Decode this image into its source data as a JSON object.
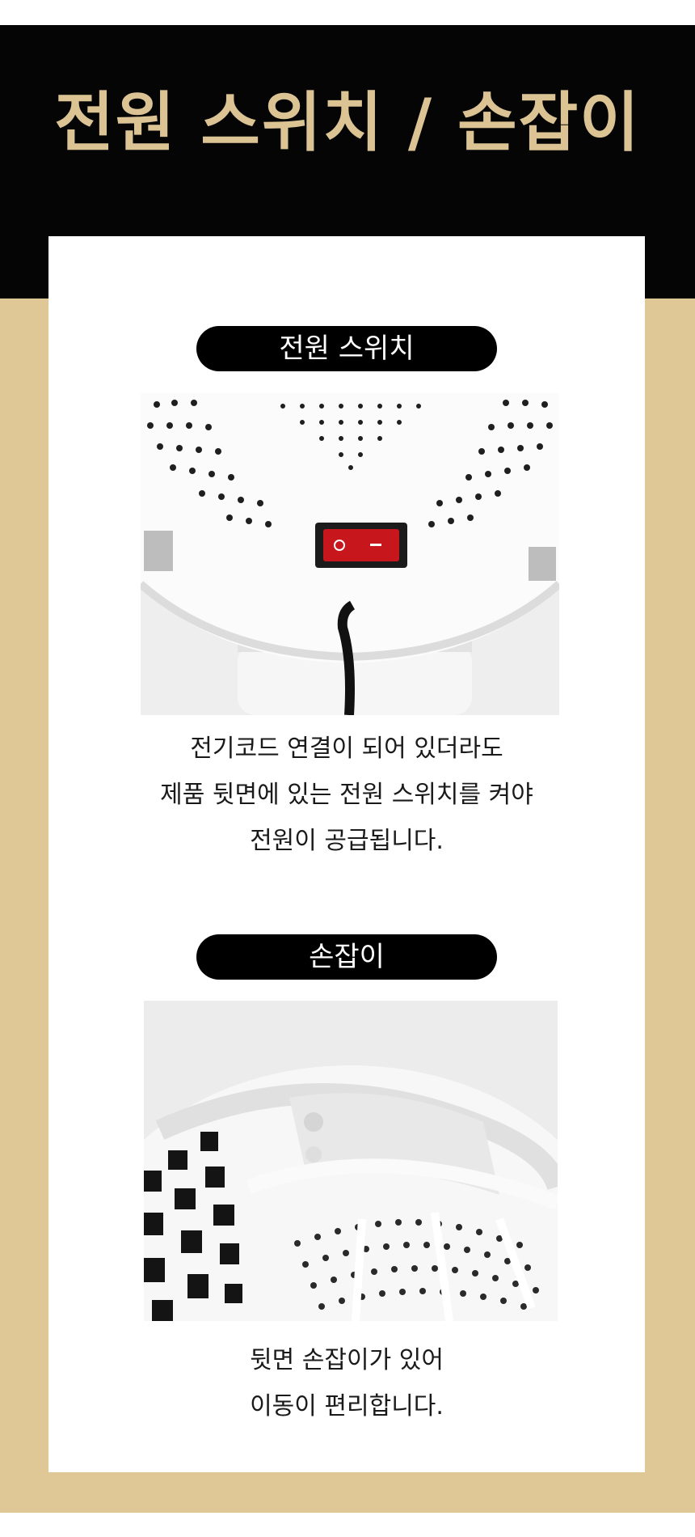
{
  "header": {
    "title": "전원 스위치 / 손잡이"
  },
  "sections": [
    {
      "label": "전원 스위치",
      "image_alt": "power-switch-photo",
      "caption_lines": [
        "전기코드 연결이 되어 있더라도",
        "제품 뒷면에 있는 전원 스위치를 켜야",
        "전원이 공급됩니다."
      ]
    },
    {
      "label": "손잡이",
      "image_alt": "handle-photo",
      "caption_lines": [
        "뒷면 손잡이가 있어",
        "이동이 편리합니다."
      ]
    }
  ],
  "switch_mark": "O",
  "colors": {
    "header_bg": "#050505",
    "title_gold": "#dcc394",
    "page_gold": "#dfc796",
    "switch_red": "#c8161d"
  }
}
